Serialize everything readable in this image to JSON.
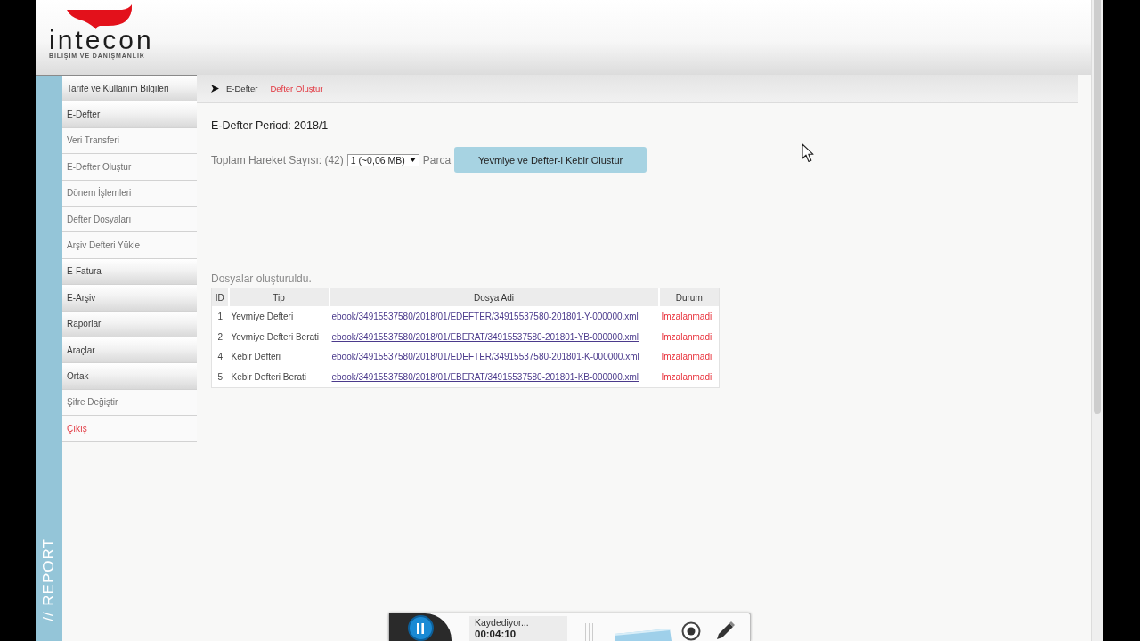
{
  "header": {
    "logo_text": "intecon",
    "logo_tagline": "BILIŞIM VE DANIŞMANLIK"
  },
  "sidebar": {
    "side_label": "// REPORT",
    "items": [
      {
        "label": "Tarife ve Kullanım Bilgileri",
        "kind": "section"
      },
      {
        "label": "E-Defter",
        "kind": "section",
        "children": [
          {
            "label": "Veri Transferi",
            "kind": "link"
          },
          {
            "label": "E-Defter Oluştur",
            "kind": "link"
          },
          {
            "label": "Dönem İşlemleri",
            "kind": "link"
          },
          {
            "label": "Defter Dosyaları",
            "kind": "link"
          },
          {
            "label": "Arşiv Defteri Yükle",
            "kind": "link"
          }
        ]
      },
      {
        "label": "E-Fatura",
        "kind": "section"
      },
      {
        "label": "E-Arşiv",
        "kind": "section"
      },
      {
        "label": "Raporlar",
        "kind": "section"
      },
      {
        "label": "Araçlar",
        "kind": "section"
      },
      {
        "label": "Ortak",
        "kind": "section"
      },
      {
        "label": "Şifre Değiştir",
        "kind": "link"
      },
      {
        "label": "Çıkış",
        "kind": "exit"
      }
    ]
  },
  "breadcrumb": [
    {
      "label": "E-Defter",
      "current": false
    },
    {
      "label": "Defter Oluştur",
      "current": true
    }
  ],
  "period_title": "E-Defter Period: 2018/1",
  "parts": {
    "label": "Toplam Hareket Sayısı: (42)",
    "select_value": "1 (~0,06 MB)",
    "suffix": "Parca",
    "button": "Yevmiye ve Defter-i Kebir Olustur"
  },
  "result_message": "Dosyalar oluşturuldu.",
  "table": {
    "columns": [
      "ID",
      "Tip",
      "Dosya Adi",
      "Durum"
    ],
    "rows": [
      {
        "id": "1",
        "tip": "Yevmiye Defteri",
        "file": "ebook/34915537580/2018/01/EDEFTER/34915537580-201801-Y-000000.xml",
        "status": "Imzalanmadi"
      },
      {
        "id": "2",
        "tip": "Yevmiye Defteri Berati",
        "file": "ebook/34915537580/2018/01/EBERAT/34915537580-201801-YB-000000.xml",
        "status": "Imzalanmadi"
      },
      {
        "id": "4",
        "tip": "Kebir Defteri",
        "file": "ebook/34915537580/2018/01/EDEFTER/34915537580-201801-K-000000.xml",
        "status": "Imzalanmadi"
      },
      {
        "id": "5",
        "tip": "Kebir Defteri Berati",
        "file": "ebook/34915537580/2018/01/EBERAT/34915537580-201801-KB-000000.xml",
        "status": "Imzalanmadi"
      }
    ]
  },
  "recorder": {
    "status": "Kaydediyor...",
    "time": "00:04:10"
  }
}
